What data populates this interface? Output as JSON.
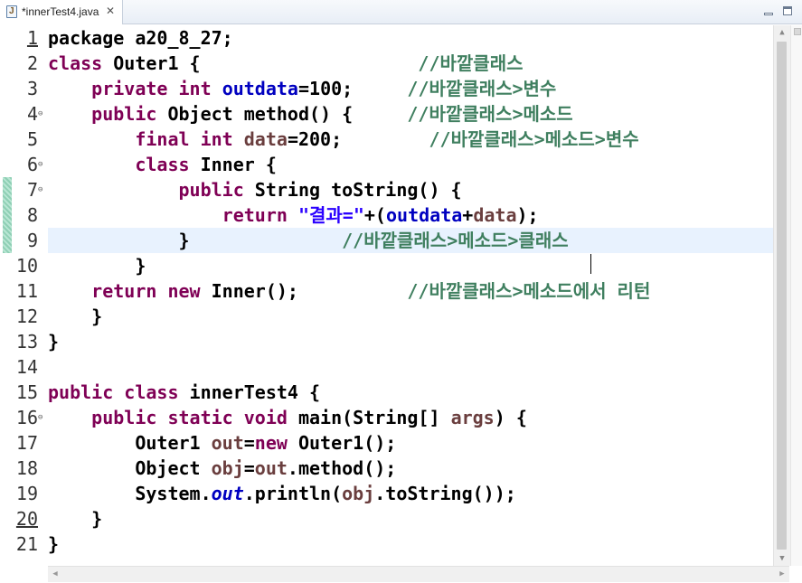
{
  "tab": {
    "title": "*innerTest4.java",
    "icon": "java-file-icon",
    "icon_letter": "J",
    "close": "✕"
  },
  "code_lines": [
    {
      "n": "1",
      "segs": [
        {
          "t": "package a20_8_27;",
          "c": ""
        }
      ]
    },
    {
      "n": "2",
      "segs": [
        {
          "t": "class",
          "c": "kw"
        },
        {
          "t": " Outer1 {                    ",
          "c": ""
        },
        {
          "t": "//바깥클래스",
          "c": "cmt"
        }
      ]
    },
    {
      "n": "3",
      "segs": [
        {
          "t": "    ",
          "c": ""
        },
        {
          "t": "private",
          "c": "kw"
        },
        {
          "t": " ",
          "c": ""
        },
        {
          "t": "int",
          "c": "kw"
        },
        {
          "t": " ",
          "c": ""
        },
        {
          "t": "outdata",
          "c": "fld"
        },
        {
          "t": "=100;     ",
          "c": ""
        },
        {
          "t": "//바깥클래스>변수",
          "c": "cmt"
        }
      ]
    },
    {
      "n": "4",
      "segs": [
        {
          "t": "    ",
          "c": ""
        },
        {
          "t": "public",
          "c": "kw"
        },
        {
          "t": " Object method() {     ",
          "c": ""
        },
        {
          "t": "//바깥클래스>메소드",
          "c": "cmt"
        }
      ]
    },
    {
      "n": "5",
      "segs": [
        {
          "t": "        ",
          "c": ""
        },
        {
          "t": "final",
          "c": "kw"
        },
        {
          "t": " ",
          "c": ""
        },
        {
          "t": "int",
          "c": "kw"
        },
        {
          "t": " ",
          "c": ""
        },
        {
          "t": "data",
          "c": "loc"
        },
        {
          "t": "=200;        ",
          "c": ""
        },
        {
          "t": "//바깥클래스>메소드>변수",
          "c": "cmt"
        }
      ]
    },
    {
      "n": "6",
      "segs": [
        {
          "t": "        ",
          "c": ""
        },
        {
          "t": "class",
          "c": "kw"
        },
        {
          "t": " Inner {",
          "c": ""
        }
      ]
    },
    {
      "n": "7",
      "segs": [
        {
          "t": "            ",
          "c": ""
        },
        {
          "t": "public",
          "c": "kw"
        },
        {
          "t": " String toString() {",
          "c": ""
        }
      ]
    },
    {
      "n": "8",
      "segs": [
        {
          "t": "                ",
          "c": ""
        },
        {
          "t": "return",
          "c": "kw"
        },
        {
          "t": " ",
          "c": ""
        },
        {
          "t": "\"결과=\"",
          "c": "str"
        },
        {
          "t": "+(",
          "c": ""
        },
        {
          "t": "outdata",
          "c": "fld"
        },
        {
          "t": "+",
          "c": ""
        },
        {
          "t": "data",
          "c": "loc"
        },
        {
          "t": ");",
          "c": ""
        }
      ]
    },
    {
      "n": "9",
      "segs": [
        {
          "t": "            }              ",
          "c": ""
        },
        {
          "t": "//바깥클래스>메소드>클래스",
          "c": "cmt"
        }
      ]
    },
    {
      "n": "10",
      "segs": [
        {
          "t": "        }",
          "c": ""
        }
      ]
    },
    {
      "n": "11",
      "segs": [
        {
          "t": "    ",
          "c": ""
        },
        {
          "t": "return",
          "c": "kw"
        },
        {
          "t": " ",
          "c": ""
        },
        {
          "t": "new",
          "c": "kw"
        },
        {
          "t": " Inner();          ",
          "c": ""
        },
        {
          "t": "//바깥클래스>메소드에서 리턴",
          "c": "cmt"
        }
      ]
    },
    {
      "n": "12",
      "segs": [
        {
          "t": "    }",
          "c": ""
        }
      ]
    },
    {
      "n": "13",
      "segs": [
        {
          "t": "}",
          "c": ""
        }
      ]
    },
    {
      "n": "14",
      "segs": []
    },
    {
      "n": "15",
      "segs": [
        {
          "t": "public",
          "c": "kw"
        },
        {
          "t": " ",
          "c": ""
        },
        {
          "t": "class",
          "c": "kw"
        },
        {
          "t": " innerTest4 {",
          "c": ""
        }
      ]
    },
    {
      "n": "16",
      "segs": [
        {
          "t": "    ",
          "c": ""
        },
        {
          "t": "public",
          "c": "kw"
        },
        {
          "t": " ",
          "c": ""
        },
        {
          "t": "static",
          "c": "kw"
        },
        {
          "t": " ",
          "c": ""
        },
        {
          "t": "void",
          "c": "kw"
        },
        {
          "t": " main(String[] ",
          "c": ""
        },
        {
          "t": "args",
          "c": "loc"
        },
        {
          "t": ") {",
          "c": ""
        }
      ]
    },
    {
      "n": "17",
      "segs": [
        {
          "t": "        Outer1 ",
          "c": ""
        },
        {
          "t": "out",
          "c": "loc"
        },
        {
          "t": "=",
          "c": ""
        },
        {
          "t": "new",
          "c": "kw"
        },
        {
          "t": " Outer1();",
          "c": ""
        }
      ]
    },
    {
      "n": "18",
      "segs": [
        {
          "t": "        Object ",
          "c": ""
        },
        {
          "t": "obj",
          "c": "loc"
        },
        {
          "t": "=",
          "c": ""
        },
        {
          "t": "out",
          "c": "loc"
        },
        {
          "t": ".method();",
          "c": ""
        }
      ]
    },
    {
      "n": "19",
      "segs": [
        {
          "t": "        System.",
          "c": ""
        },
        {
          "t": "out",
          "c": "stat"
        },
        {
          "t": ".println(",
          "c": ""
        },
        {
          "t": "obj",
          "c": "loc"
        },
        {
          "t": ".toString());",
          "c": ""
        }
      ]
    },
    {
      "n": "20",
      "segs": [
        {
          "t": "    }",
          "c": ""
        }
      ]
    },
    {
      "n": "21",
      "segs": [
        {
          "t": "}",
          "c": ""
        }
      ]
    }
  ],
  "folded_lines": [
    "4",
    "6",
    "7",
    "16"
  ],
  "underlined_lines": [
    "1",
    "20"
  ],
  "current_line": "9",
  "colors": {
    "keyword": "#7f0055",
    "field": "#0000c0",
    "local": "#6a3e3e",
    "string": "#2a00ff",
    "comment": "#3f7f5f",
    "current_line": "#e8f2fe"
  }
}
